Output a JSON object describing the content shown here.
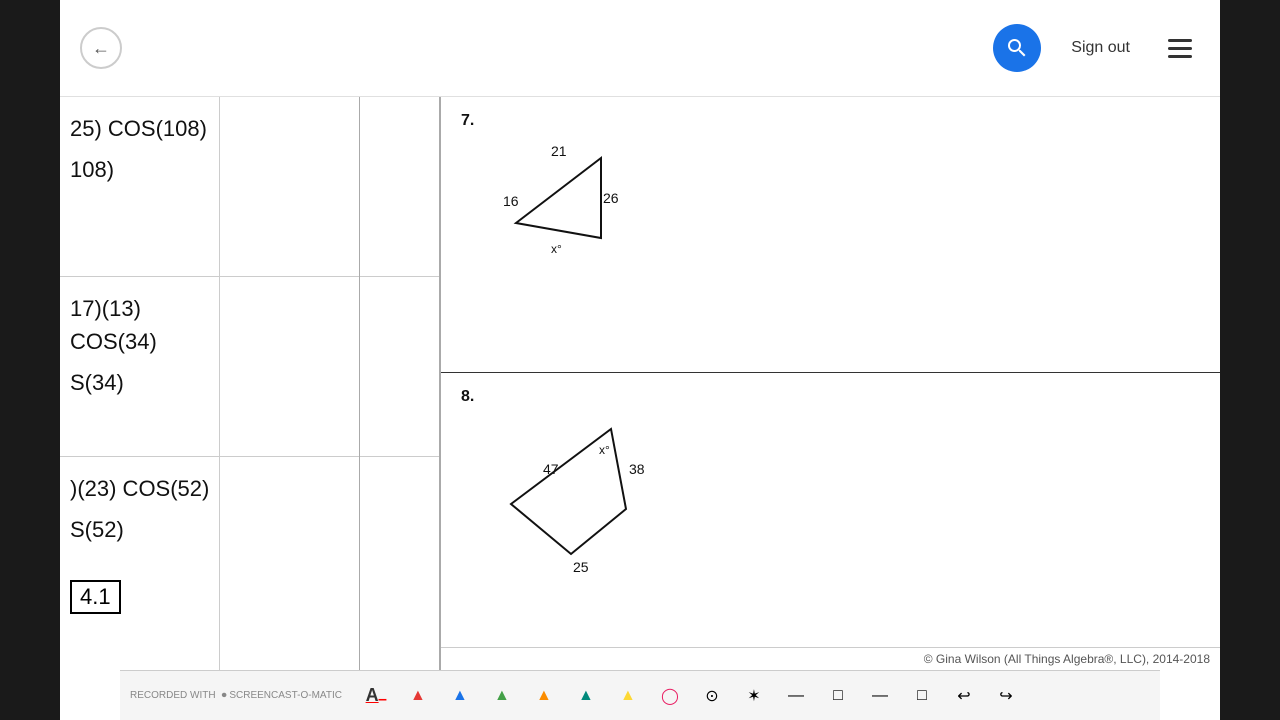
{
  "header": {
    "back_button_label": "←",
    "sign_out_label": "Sign out",
    "menu_label": "☰"
  },
  "left_sections": [
    {
      "id": "section1",
      "lines": [
        "25) COS(108)",
        "",
        "108)"
      ],
      "formula_lines": [
        "(25)(COS(108)",
        "S(34)"
      ],
      "has_box": false
    },
    {
      "id": "section2",
      "lines": [
        "17)(13) COS(34)",
        "",
        "S(34)"
      ],
      "has_box": false
    },
    {
      "id": "section3",
      "lines": [
        ")(23) COS(52)",
        "",
        "S(52)",
        "4.1"
      ],
      "has_box": true,
      "box_value": "4.1"
    }
  ],
  "problems": [
    {
      "number": "7.",
      "triangle": {
        "sides": [
          "21",
          "26",
          "16"
        ],
        "angle": "x°",
        "type": "triangle"
      }
    },
    {
      "number": "8.",
      "triangle": {
        "sides": [
          "47",
          "38",
          "25"
        ],
        "angle": "x°",
        "type": "quadrilateral"
      }
    }
  ],
  "copyright": "© Gina Wilson (All Things Algebra®, LLC), 2014-2018",
  "copyright_left": "®, LLC), 2014-2018",
  "watermark": {
    "recorded_with": "RECORDED WITH",
    "brand": "SCREENCAST-O-MATIC"
  },
  "toolbar": {
    "tools": [
      "A",
      "▲",
      "▲",
      "▲",
      "▲",
      "▲",
      "▲",
      "◯",
      "◉",
      "✶",
      "—",
      "□",
      "—",
      "□",
      "↩",
      "↪"
    ]
  }
}
